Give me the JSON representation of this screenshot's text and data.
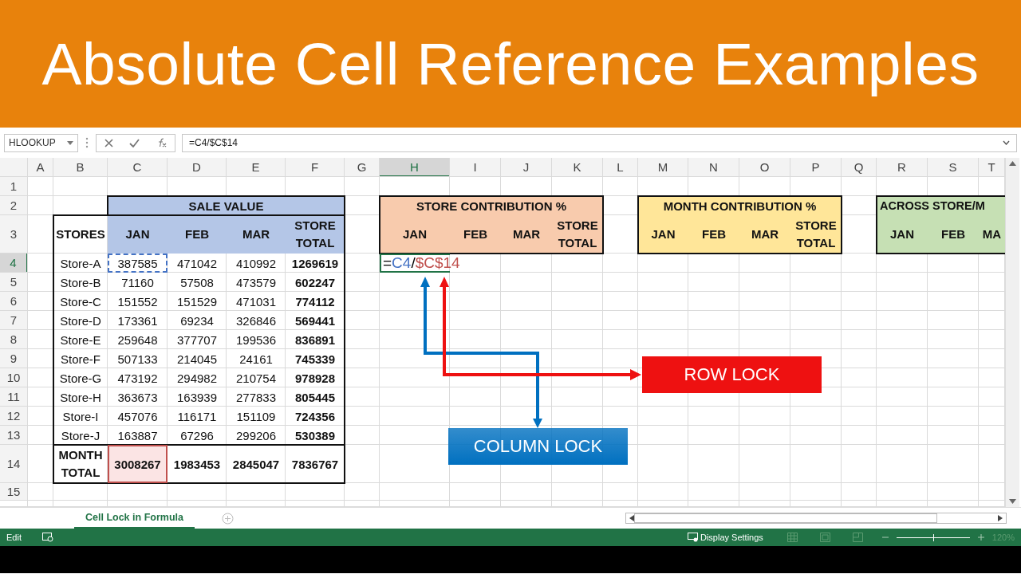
{
  "banner": {
    "title": "Absolute Cell Reference Examples"
  },
  "formula_bar": {
    "name_box": "HLOOKUP",
    "formula": "=C4/$C$14"
  },
  "columns": [
    {
      "label": "A",
      "selected": false
    },
    {
      "label": "B",
      "selected": false
    },
    {
      "label": "C",
      "selected": false
    },
    {
      "label": "D",
      "selected": false
    },
    {
      "label": "E",
      "selected": false
    },
    {
      "label": "F",
      "selected": false
    },
    {
      "label": "G",
      "selected": false
    },
    {
      "label": "H",
      "selected": true
    },
    {
      "label": "I",
      "selected": false
    },
    {
      "label": "J",
      "selected": false
    },
    {
      "label": "K",
      "selected": false
    },
    {
      "label": "L",
      "selected": false
    },
    {
      "label": "M",
      "selected": false
    },
    {
      "label": "N",
      "selected": false
    },
    {
      "label": "O",
      "selected": false
    },
    {
      "label": "P",
      "selected": false
    },
    {
      "label": "Q",
      "selected": false
    },
    {
      "label": "R",
      "selected": false
    },
    {
      "label": "S",
      "selected": false
    },
    {
      "label": "T",
      "selected": false
    }
  ],
  "rows": [
    {
      "label": "1",
      "selected": false
    },
    {
      "label": "2",
      "selected": false
    },
    {
      "label": "3",
      "selected": false
    },
    {
      "label": "4",
      "selected": true
    },
    {
      "label": "5",
      "selected": false
    },
    {
      "label": "6",
      "selected": false
    },
    {
      "label": "7",
      "selected": false
    },
    {
      "label": "8",
      "selected": false
    },
    {
      "label": "9",
      "selected": false
    },
    {
      "label": "10",
      "selected": false
    },
    {
      "label": "11",
      "selected": false
    },
    {
      "label": "12",
      "selected": false
    },
    {
      "label": "13",
      "selected": false
    },
    {
      "label": "14",
      "selected": false
    },
    {
      "label": "15",
      "selected": false
    }
  ],
  "sale_table": {
    "title": "SALE VALUE",
    "headers": [
      "STORES",
      "JAN",
      "FEB",
      "MAR",
      "STORE TOTAL"
    ],
    "rows": [
      {
        "store": "Store-A",
        "values": [
          "387585",
          "471042",
          "410992"
        ],
        "total": "1269619",
        "highlight": {
          "color": "#4472c4"
        }
      },
      {
        "store": "Store-B",
        "values": [
          "71160",
          "57508",
          "473579"
        ],
        "total": "602247"
      },
      {
        "store": "Store-C",
        "values": [
          "151552",
          "151529",
          "471031"
        ],
        "total": "774112"
      },
      {
        "store": "Store-D",
        "values": [
          "173361",
          "69234",
          "326846"
        ],
        "total": "569441"
      },
      {
        "store": "Store-E",
        "values": [
          "259648",
          "377707",
          "199536"
        ],
        "total": "836891"
      },
      {
        "store": "Store-F",
        "values": [
          "507133",
          "214045",
          "24161"
        ],
        "total": "745339"
      },
      {
        "store": "Store-G",
        "values": [
          "473192",
          "294982",
          "210754"
        ],
        "total": "978928"
      },
      {
        "store": "Store-H",
        "values": [
          "363673",
          "163939",
          "277833"
        ],
        "total": "805445"
      },
      {
        "store": "Store-I",
        "values": [
          "457076",
          "116171",
          "151109"
        ],
        "total": "724356"
      },
      {
        "store": "Store-J",
        "values": [
          "163887",
          "67296",
          "299206"
        ],
        "total": "530389"
      }
    ],
    "total_row": {
      "label": "MONTH TOTAL",
      "values": [
        "3008267",
        "1983453",
        "2845047"
      ],
      "total": "7836767",
      "highlight": {
        "color": "#c0504d"
      }
    }
  },
  "contribution_tables": [
    {
      "title": "STORE CONTRIBUTION %",
      "color": "#f8cbad",
      "headers": [
        "JAN",
        "FEB",
        "MAR",
        "STORE TOTAL"
      ]
    },
    {
      "title": "MONTH CONTRIBUTION %",
      "color": "#ffe699",
      "headers": [
        "JAN",
        "FEB",
        "MAR",
        "STORE TOTAL"
      ]
    },
    {
      "title": "ACROSS STORE/M",
      "color": "#c6e0b4",
      "headers": [
        "JAN",
        "FEB",
        "MA"
      ]
    }
  ],
  "editing_cell": {
    "parts": [
      {
        "text": "=",
        "color": "#000000"
      },
      {
        "text": "C4",
        "color": "#4472c4"
      },
      {
        "text": "/",
        "color": "#000000"
      },
      {
        "text": "$C$14",
        "color": "#c0504d"
      }
    ]
  },
  "callouts": [
    {
      "label": "ROW LOCK",
      "color": "#ee1111"
    },
    {
      "label": "COLUMN LOCK",
      "color": "#0070c0"
    }
  ],
  "sheet_tabs": [
    {
      "label": "Cell Lock in Formula",
      "selected": true
    }
  ],
  "status_bar": {
    "mode": "Edit",
    "display_settings": "Display Settings",
    "zoom_slider": {
      "level": 0.5
    },
    "zoom": "120%"
  }
}
